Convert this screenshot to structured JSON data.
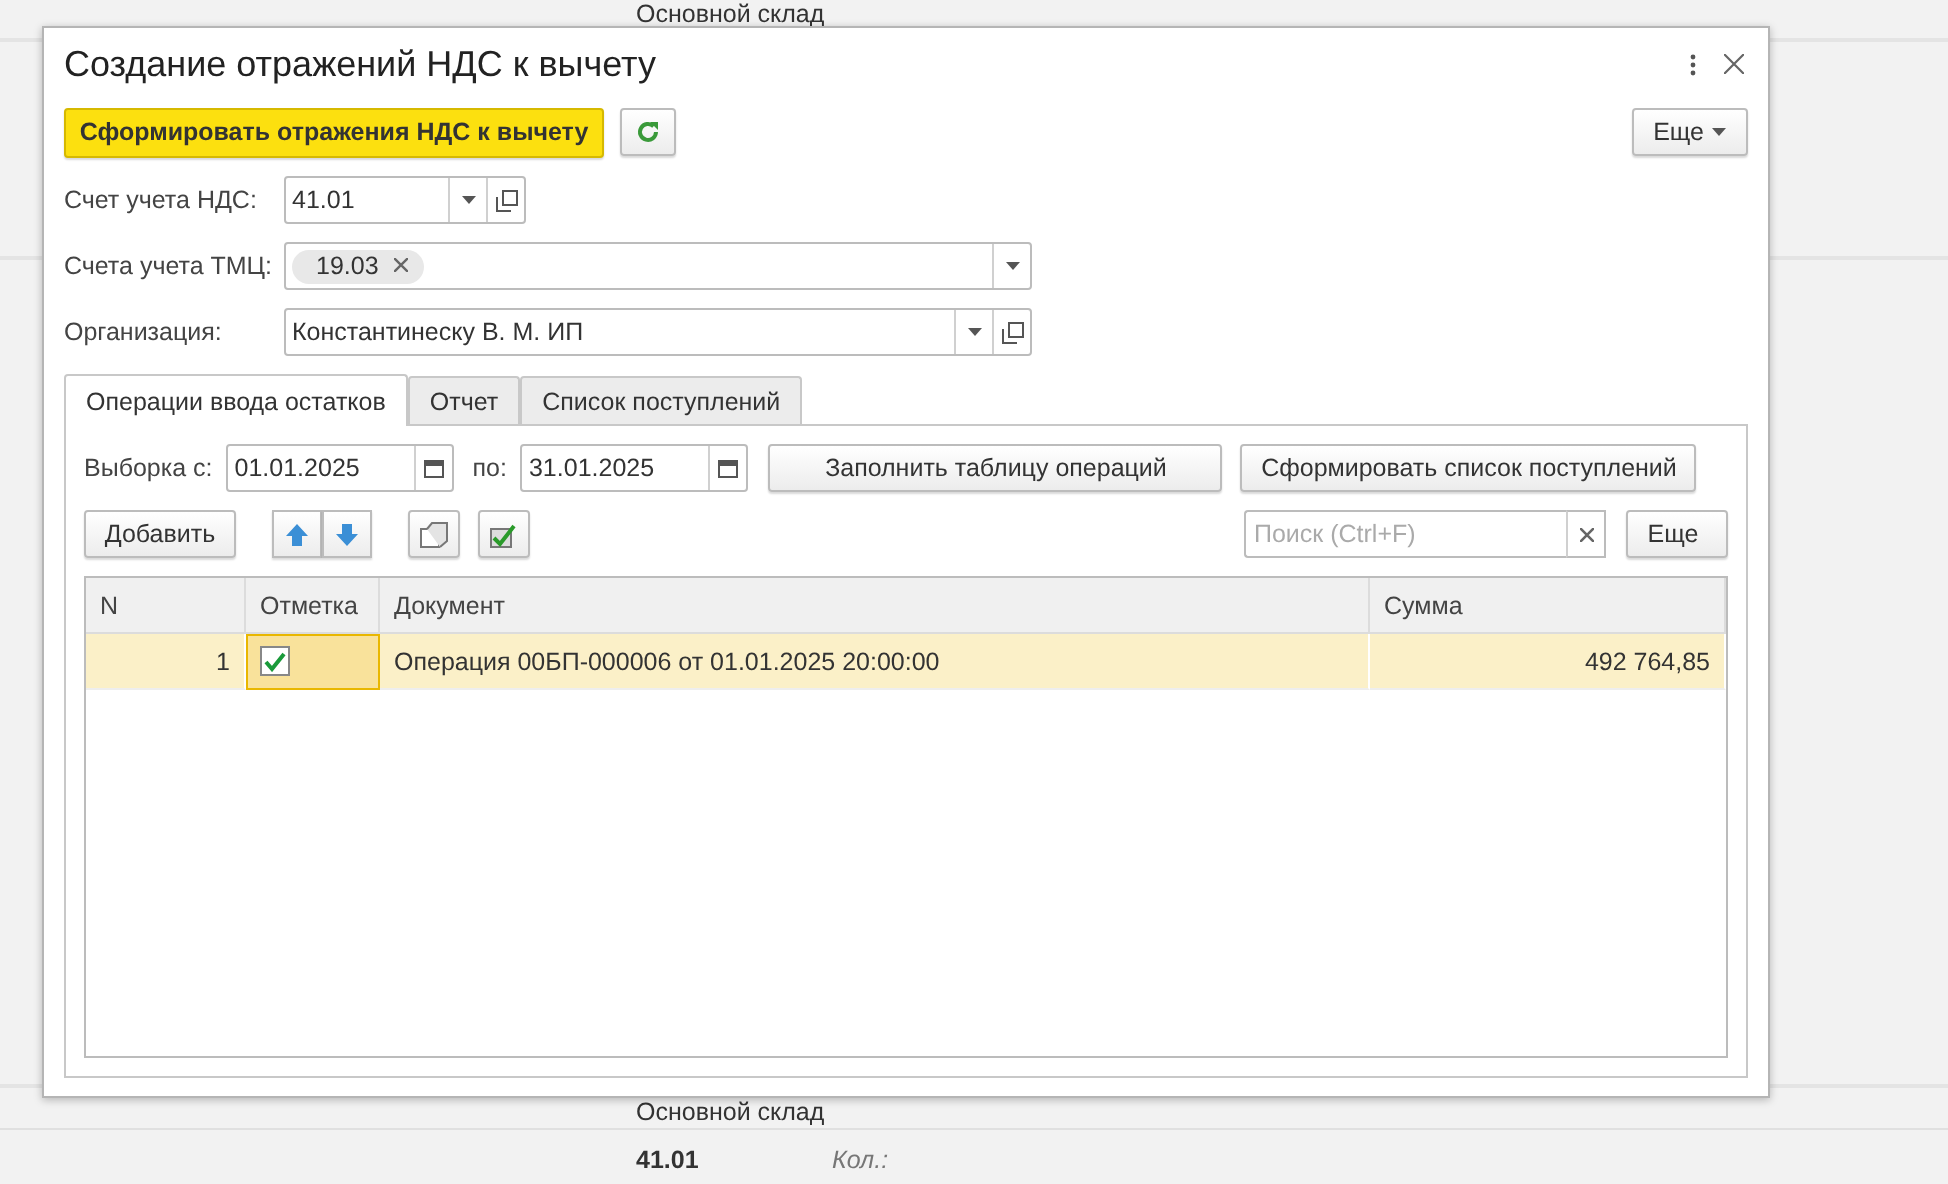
{
  "background": {
    "top_label": "Основной склад",
    "bottom_label": "Основной склад",
    "account": "41.01",
    "quantity_label": "Кол.:"
  },
  "dialog": {
    "title": "Создание отражений НДС к вычету"
  },
  "toolbar": {
    "primary_button": "Сформировать отражения НДС к вычету",
    "more_button": "Еще"
  },
  "fields": [
    {
      "label": "Счет учета НДС:",
      "kind": "select",
      "value": "41.01",
      "open_button": true
    },
    {
      "label": "Счета учета ТМЦ:",
      "kind": "tags",
      "tags": [
        "19.03"
      ],
      "open_button": false
    },
    {
      "label": "Организация:",
      "kind": "select",
      "value": "Константинеску В. М. ИП",
      "open_button": true
    }
  ],
  "tabs": [
    {
      "label": "Операции ввода остатков",
      "selected": true
    },
    {
      "label": "Отчет",
      "selected": false
    },
    {
      "label": "Список поступлений",
      "selected": false
    }
  ],
  "period": {
    "from_label": "Выборка с:",
    "from": "01.01.2025",
    "to_label": "по:",
    "to": "31.01.2025"
  },
  "period_buttons": [
    "Заполнить таблицу операций",
    "Сформировать список поступлений"
  ],
  "table_toolbar": {
    "add_button": "Добавить",
    "search": {
      "placeholder": "Поиск (Ctrl+F)"
    },
    "more_button": "Еще"
  },
  "table": {
    "columns": [
      "N",
      "Отметка",
      "Документ",
      "Сумма"
    ],
    "rows": [
      {
        "n": "1",
        "checked": true,
        "document": "Операция 00БП-000006 от 01.01.2025 20:00:00",
        "amount": "492 764,85",
        "selected": true
      }
    ]
  }
}
